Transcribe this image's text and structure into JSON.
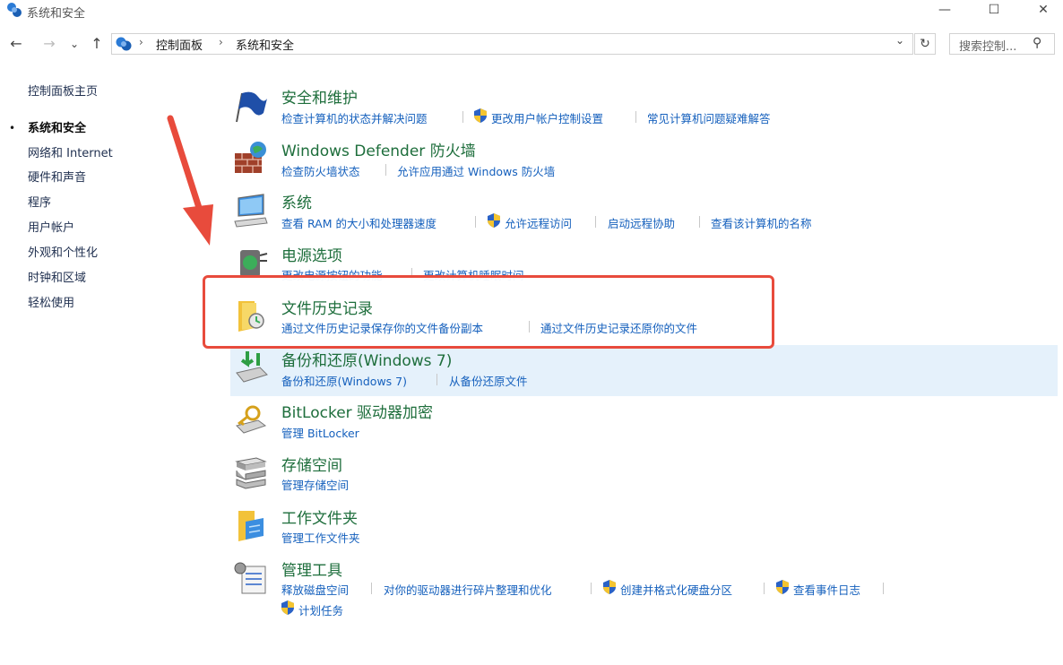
{
  "window": {
    "title": "系统和安全",
    "buttons": {
      "minimize": "—",
      "maximize": "☐",
      "close": "✕"
    }
  },
  "address": {
    "back": "←",
    "forward": "→",
    "recent": "⌄",
    "up": "↑",
    "breadcrumbs": [
      "控制面板",
      "系统和安全"
    ],
    "separator": "›",
    "dropdown": "⌄",
    "refresh": "↻",
    "search_placeholder": "搜索控制...",
    "search_icon": "⚲"
  },
  "sidebar": {
    "home": "控制面板主页",
    "bullet": "•",
    "items": [
      "系统和安全",
      "网络和 Internet",
      "硬件和声音",
      "程序",
      "用户帐户",
      "外观和个性化",
      "时钟和区域",
      "轻松使用"
    ],
    "current_index": 0
  },
  "categories": [
    {
      "icon": "flag-icon",
      "title": "安全和维护",
      "links": [
        "检查计算机的状态并解决问题",
        "更改用户帐户控制设置",
        "常见计算机问题疑难解答"
      ]
    },
    {
      "icon": "firewall-icon",
      "title": "Windows Defender 防火墙",
      "links": [
        "检查防火墙状态",
        "允许应用通过 Windows 防火墙"
      ]
    },
    {
      "icon": "computer-icon",
      "title": "系统",
      "links": [
        "查看 RAM 的大小和处理器速度",
        "允许远程访问",
        "启动远程协助",
        "查看该计算机的名称"
      ]
    },
    {
      "icon": "power-icon",
      "title": "电源选项",
      "links": [
        "更改电源按钮的功能",
        "更改计算机睡眠时间"
      ]
    },
    {
      "icon": "file-history-icon",
      "title": "文件历史记录",
      "links": [
        "通过文件历史记录保存你的文件备份副本",
        "通过文件历史记录还原你的文件"
      ]
    },
    {
      "icon": "backup-icon",
      "title": "备份和还原(Windows 7)",
      "links": [
        "备份和还原(Windows 7)",
        "从备份还原文件"
      ]
    },
    {
      "icon": "bitlocker-icon",
      "title": "BitLocker 驱动器加密",
      "links": [
        "管理 BitLocker"
      ]
    },
    {
      "icon": "storage-icon",
      "title": "存储空间",
      "links": [
        "管理存储空间"
      ]
    },
    {
      "icon": "work-folders-icon",
      "title": "工作文件夹",
      "links": [
        "管理工作文件夹"
      ]
    },
    {
      "icon": "admin-tools-icon",
      "title": "管理工具",
      "links": [
        "释放磁盘空间",
        "对你的驱动器进行碎片整理和优化",
        "创建并格式化硬盘分区",
        "查看事件日志",
        "计划任务"
      ]
    }
  ],
  "colors": {
    "title_link": "#1e6e3c",
    "link": "#1560bd",
    "highlight": "#e84b3c",
    "hover_row": "#e5f1fb"
  }
}
